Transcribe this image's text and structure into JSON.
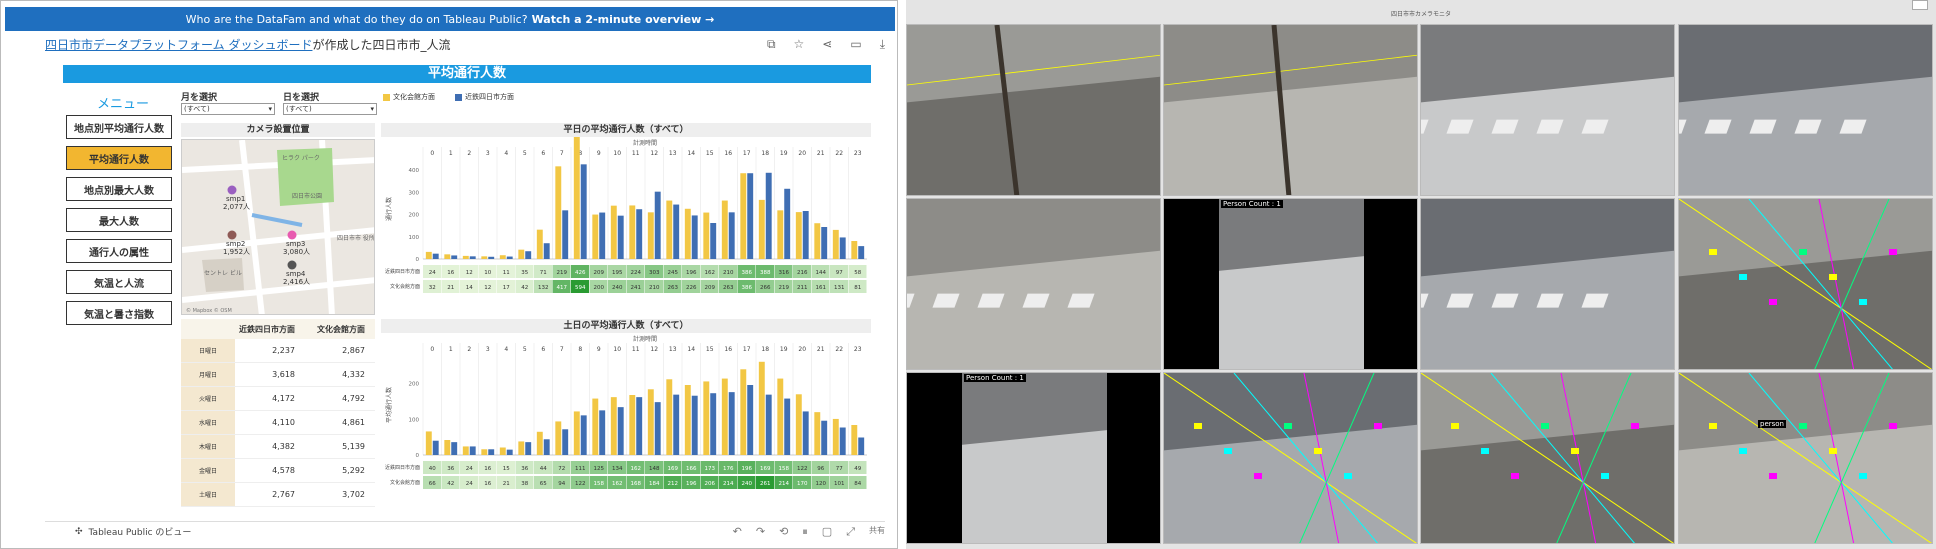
{
  "banner": {
    "text": "Who are the DataFam and what do they do on Tableau Public?",
    "link": "Watch a 2-minute overview →"
  },
  "titlebar": {
    "author": "四日市市データプラットフォーム ダッシュボード",
    "mid": "が作成した",
    "title": "四日市市_人流"
  },
  "dashboard": {
    "title": "平均通行人数",
    "menu_title": "メニュー",
    "menu": [
      "地点別平均通行人数",
      "平均通行人数",
      "地点別最大人数",
      "最大人数",
      "通行人の属性",
      "気温と人流",
      "気温と暑さ指数"
    ],
    "active_menu": 1,
    "filter_month": {
      "label": "月を選択",
      "value": "(すべて)"
    },
    "filter_day": {
      "label": "日を選択",
      "value": "(すべて)"
    },
    "legend": [
      {
        "name": "文化会館方面",
        "color": "#f2c744"
      },
      {
        "name": "近鉄四日市方面",
        "color": "#3f6eb3"
      }
    ],
    "map": {
      "title": "カメラ設置位置",
      "attribution": "© Mapbox © OSM",
      "labels": {
        "place1": "ヒラク\nパーク",
        "place2": "四日市公園",
        "place3": "セントレ\nビル",
        "place4": "四日市市\n役所"
      },
      "points": [
        {
          "name": "smp1",
          "value": "2,077人",
          "color": "#9a5fc0"
        },
        {
          "name": "smp2",
          "value": "1,952人",
          "color": "#8e5a55"
        },
        {
          "name": "smp3",
          "value": "3,080人",
          "color": "#e85bb0"
        },
        {
          "name": "smp4",
          "value": "2,416人",
          "color": "#555"
        }
      ]
    },
    "table": {
      "headers": [
        "",
        "近鉄四日市方面",
        "文化会館方面"
      ],
      "rows": [
        [
          "日曜日",
          "2,237",
          "2,867"
        ],
        [
          "月曜日",
          "3,618",
          "4,332"
        ],
        [
          "火曜日",
          "4,172",
          "4,792"
        ],
        [
          "水曜日",
          "4,110",
          "4,861"
        ],
        [
          "木曜日",
          "4,382",
          "5,139"
        ],
        [
          "金曜日",
          "4,578",
          "5,292"
        ],
        [
          "土曜日",
          "2,767",
          "3,702"
        ]
      ]
    }
  },
  "chart_data": [
    {
      "type": "bar",
      "title": "平日の平均通行人数（すべて）",
      "xlabel": "計測時間",
      "ylabel": "通行人数",
      "categories": [
        "0",
        "1",
        "2",
        "3",
        "4",
        "5",
        "6",
        "7",
        "8",
        "9",
        "10",
        "11",
        "12",
        "13",
        "14",
        "15",
        "16",
        "17",
        "18",
        "19",
        "20",
        "21",
        "22",
        "23"
      ],
      "ylim": [
        0,
        450
      ],
      "yticks": [
        0,
        100,
        200,
        300,
        400
      ],
      "series": [
        {
          "name": "文化会館方面",
          "values": [
            32,
            21,
            14,
            12,
            17,
            42,
            132,
            417,
            594,
            200,
            240,
            241,
            210,
            263,
            226,
            209,
            263,
            386,
            266,
            219,
            211,
            161,
            131,
            81
          ]
        },
        {
          "name": "近鉄四日市方面",
          "values": [
            24,
            16,
            12,
            10,
            11,
            35,
            71,
            219,
            426,
            209,
            195,
            224,
            303,
            245,
            196,
            162,
            210,
            386,
            388,
            316,
            216,
            144,
            97,
            58
          ]
        }
      ],
      "row_labels": [
        "近鉄四日市方面",
        "文化会館方面"
      ]
    },
    {
      "type": "bar",
      "title": "土日の平均通行人数（すべて）",
      "xlabel": "計測時間",
      "ylabel": "平均通行人数",
      "categories": [
        "0",
        "1",
        "2",
        "3",
        "4",
        "5",
        "6",
        "7",
        "8",
        "9",
        "10",
        "11",
        "12",
        "13",
        "14",
        "15",
        "16",
        "17",
        "18",
        "19",
        "20",
        "21",
        "22",
        "23"
      ],
      "ylim": [
        0,
        280
      ],
      "yticks": [
        0,
        100,
        200
      ],
      "series": [
        {
          "name": "文化会館方面",
          "values": [
            66,
            42,
            24,
            16,
            21,
            38,
            65,
            94,
            122,
            158,
            162,
            168,
            184,
            212,
            196,
            206,
            214,
            240,
            261,
            214,
            170,
            120,
            101,
            84
          ]
        },
        {
          "name": "近鉄四日市方面",
          "values": [
            40,
            36,
            24,
            16,
            15,
            36,
            44,
            72,
            111,
            125,
            134,
            162,
            148,
            169,
            166,
            173,
            176,
            196,
            169,
            158,
            122,
            96,
            77,
            49
          ]
        }
      ],
      "row_labels": [
        "近鉄四日市方面",
        "文化会館方面"
      ]
    }
  ],
  "footer": {
    "text": "Tableau Public のビュー",
    "share": "共有"
  },
  "cameras": {
    "header": "四日市市カメラモニタ",
    "person_count": "Person Count : 1",
    "person_label": "person"
  }
}
